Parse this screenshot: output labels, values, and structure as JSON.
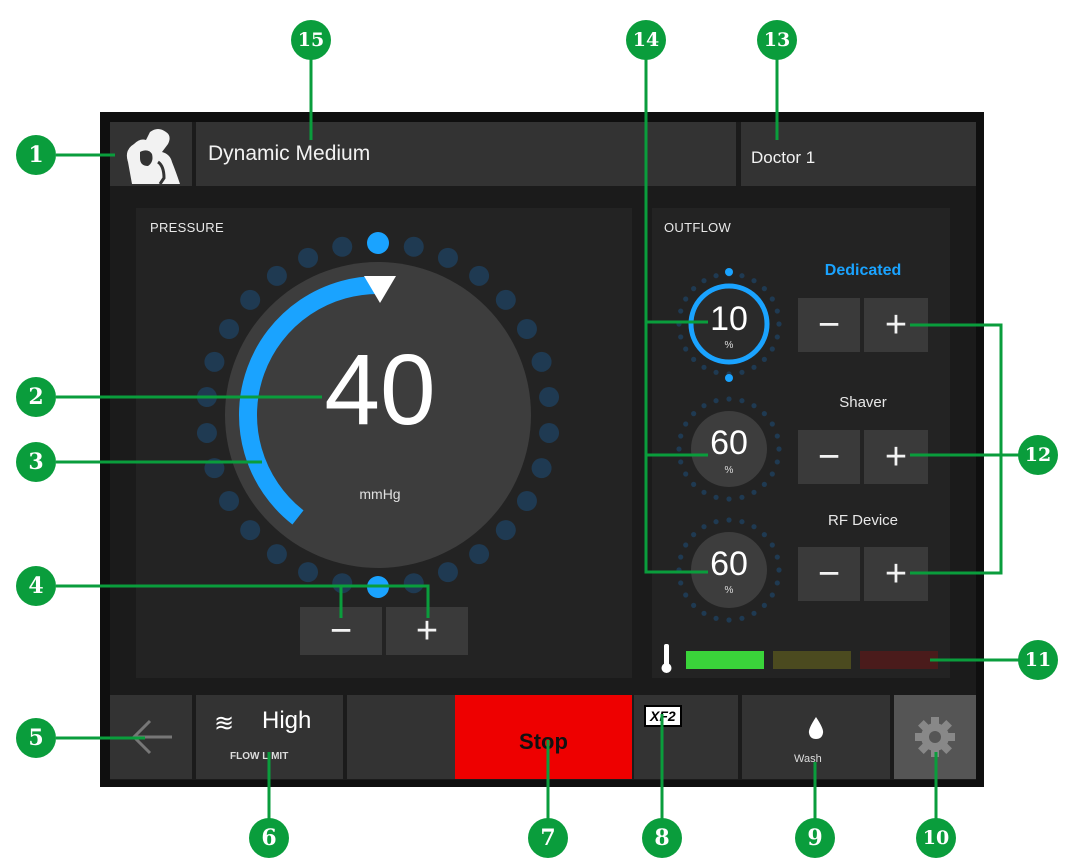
{
  "topbar": {
    "procedure": "Dynamic Medium",
    "doctor": "Doctor 1"
  },
  "pressure": {
    "title": "PRESSURE",
    "value": "40",
    "unit": "mmHg",
    "minus": "−",
    "plus": "+"
  },
  "outflow": {
    "title": "OUTFLOW",
    "devices": [
      {
        "label": "Dedicated",
        "value": "10",
        "unit": "%",
        "active": true
      },
      {
        "label": "Shaver",
        "value": "60",
        "unit": "%",
        "active": false
      },
      {
        "label": "RF Device",
        "value": "60",
        "unit": "%",
        "active": false
      }
    ],
    "minus": "−",
    "plus": "+"
  },
  "temperature_bar": {
    "segments": [
      "green",
      "olive",
      "dark-red"
    ]
  },
  "bottom": {
    "flow_limit_value": "High",
    "flow_limit_label": "FLOW LIMIT",
    "stop": "Stop",
    "xf2": "XF2",
    "wash": "Wash"
  },
  "callouts": [
    "1",
    "2",
    "3",
    "4",
    "5",
    "6",
    "7",
    "8",
    "9",
    "10",
    "11",
    "12",
    "13",
    "14",
    "15"
  ],
  "colors": {
    "accent_blue": "#1aa3ff",
    "stop_red": "#ee0000",
    "callout_green": "#0a9d3c",
    "temp_green": "#3ad43a",
    "temp_olive": "#4b4a1f",
    "temp_red": "#4a1b1b"
  }
}
